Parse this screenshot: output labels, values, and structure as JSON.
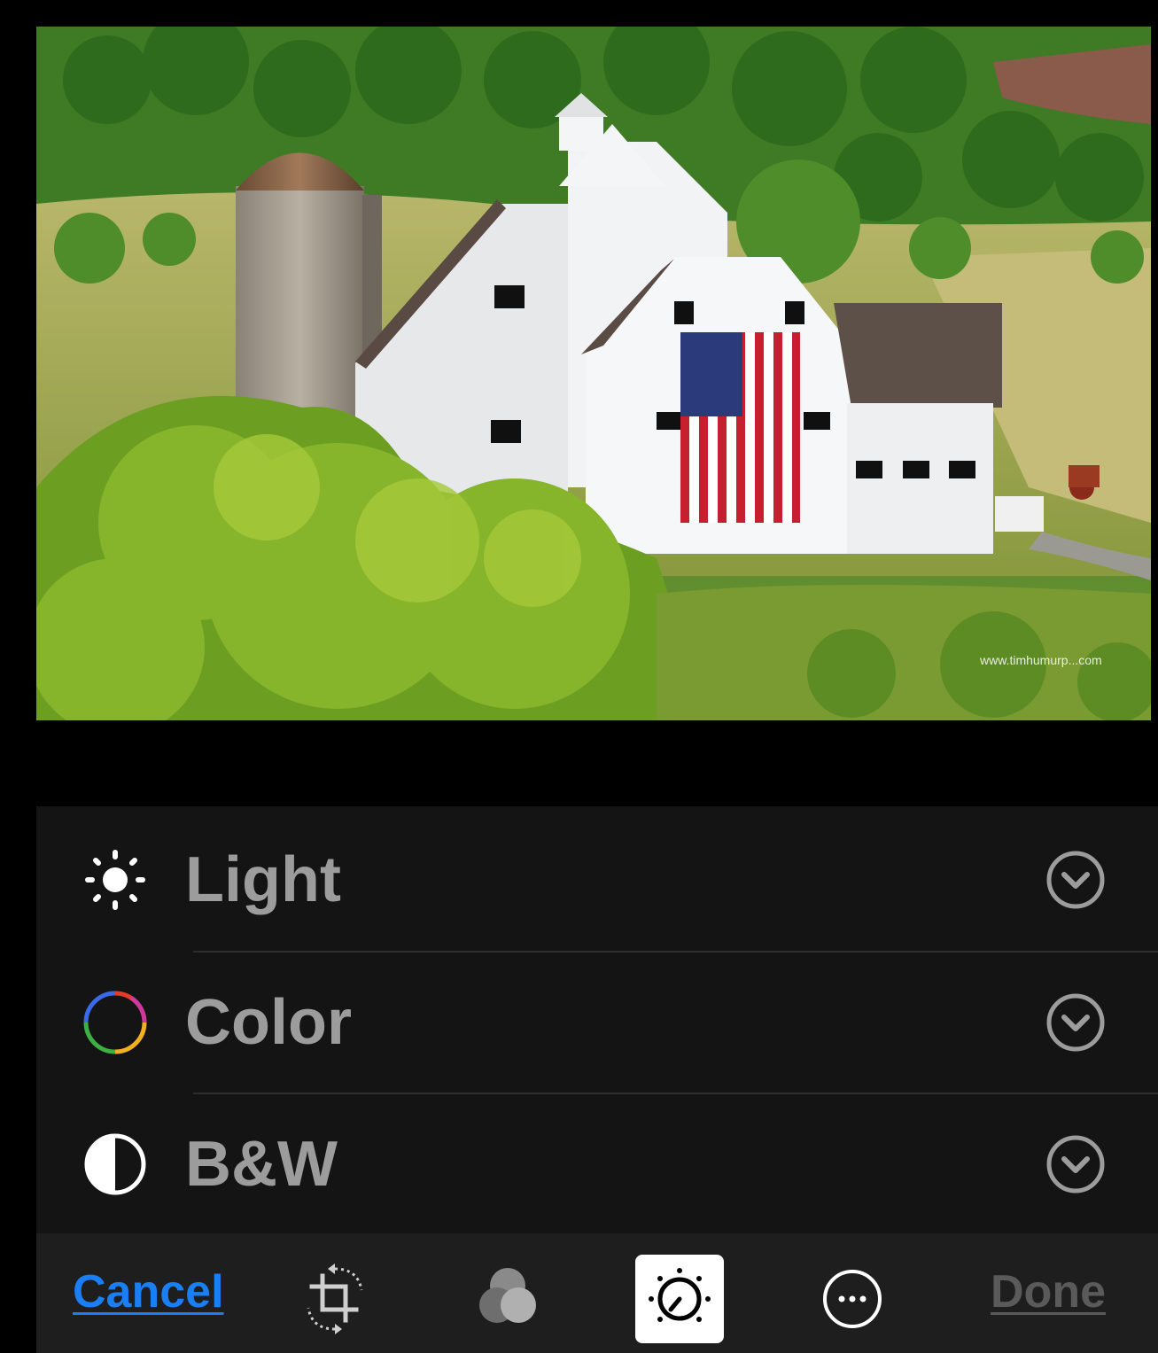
{
  "photo": {
    "description_icon": "photo-preview",
    "watermark": "www.timhumurp...com"
  },
  "adjust_panel": {
    "rows": [
      {
        "label": "Light",
        "icon": "sun-icon"
      },
      {
        "label": "Color",
        "icon": "color-wheel-icon"
      },
      {
        "label": "B&W",
        "icon": "half-circle-icon"
      }
    ],
    "expand_icon": "chevron-down-circle-icon"
  },
  "toolbar": {
    "cancel_label": "Cancel",
    "done_label": "Done",
    "tools": [
      "crop-rotate-icon",
      "filters-icon",
      "adjust-dial-icon",
      "more-icon"
    ],
    "active_tool": "adjust-dial-icon"
  },
  "colors": {
    "cancel": "#1a7ff5",
    "done_disabled": "#5a5a5a",
    "panel_bg": "#141414",
    "label": "#9c9c9c"
  }
}
